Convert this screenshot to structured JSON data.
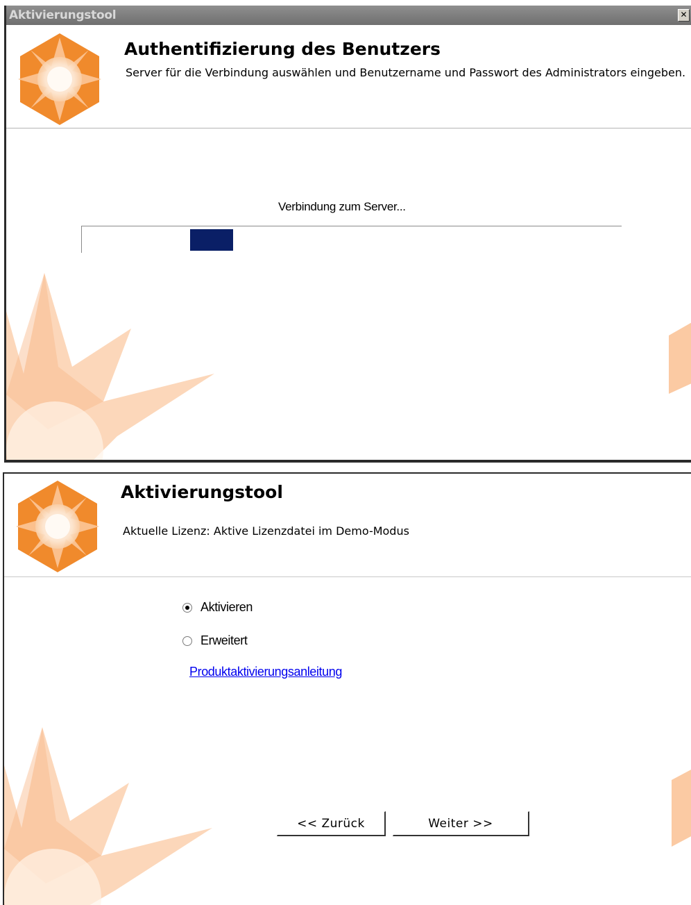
{
  "window": {
    "title": "Aktivierungstool",
    "close_glyph": "✕"
  },
  "auth_screen": {
    "title": "Authentifizierung des Benutzers",
    "subtitle": "Server für die Verbindung auswählen und Benutzername und Passwort des Administrators eingeben.",
    "status": "Verbindung zum Server...",
    "progress_indicator": "marquee"
  },
  "activation_screen": {
    "title": "Aktivierungstool",
    "license_status": "Aktuelle Lizenz: Aktive Lizenzdatei im Demo-Modus",
    "options": [
      {
        "label": "Aktivieren",
        "selected": true
      },
      {
        "label": "Erweitert",
        "selected": false
      }
    ],
    "guide_link": "Produktaktivierungsanleitung",
    "back_button": "<< Zurück",
    "next_button": "Weiter >>"
  },
  "colors": {
    "logo_orange": "#f08a2c",
    "logo_light": "#fde9d6",
    "decor_peach": "#fbcaa3",
    "progress_fill": "#0a1f66",
    "link_blue": "#0000ee"
  },
  "icons": [
    "star-logo-icon",
    "close-icon",
    "radio-icon"
  ]
}
